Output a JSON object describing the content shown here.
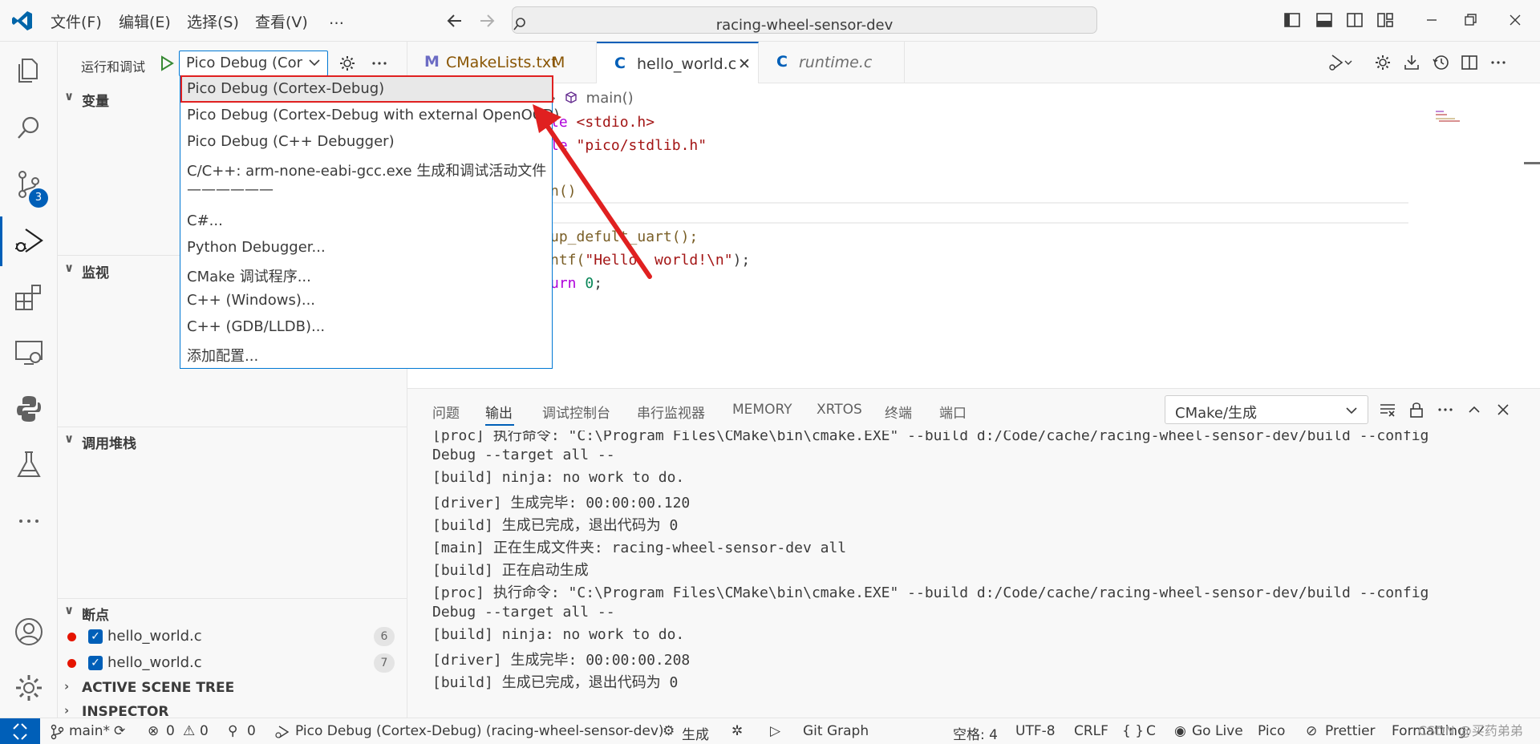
{
  "window": {
    "menus": [
      "文件(F)",
      "编辑(E)",
      "选择(S)",
      "查看(V)",
      "…"
    ],
    "search_text": "racing-wheel-sensor-dev"
  },
  "activity_bar": {
    "source_control_badge": "3"
  },
  "sidebar": {
    "title": "运行和调试",
    "selected_config": "Pico Debug (Cor",
    "sections": {
      "variables": "变量",
      "watch": "监视",
      "call_stack": "调用堆栈",
      "breakpoints": "断点",
      "active_scene_tree": "ACTIVE SCENE TREE",
      "inspector": "INSPECTOR"
    },
    "breakpoints": [
      {
        "file": "hello_world.c",
        "line": "6"
      },
      {
        "file": "hello_world.c",
        "line": "7"
      }
    ]
  },
  "dropdown": {
    "items": [
      "Pico Debug (Cortex-Debug)",
      "Pico Debug (Cortex-Debug with external OpenOCD)",
      "Pico Debug (C++ Debugger)",
      "C/C++: arm-none-eabi-gcc.exe 生成和调试活动文件",
      "——————",
      "C#...",
      "Python Debugger...",
      "CMake 调试程序...",
      "C++ (Windows)...",
      "C++ (GDB/LLDB)...",
      "添加配置..."
    ]
  },
  "tabs": [
    {
      "icon": "M",
      "label": "CMakeLists.txt",
      "suffix": "M"
    },
    {
      "icon": "C",
      "label": "hello_world.c",
      "suffix": "✕"
    },
    {
      "icon": "C",
      "label": "runtime.c",
      "suffix": ""
    }
  ],
  "editor": {
    "breadcrumb": "main()",
    "code": {
      "l1_kw": "le",
      "l1_rest": "<stdio.h>",
      "l2_kw": "le",
      "l2_rest": "\"pico/stdlib.h\"",
      "l4": "n()",
      "l6_a": "up_def",
      "l6_b": "ult_uart();",
      "l7_a": "ntf(",
      "l7_str": "\"Hello, world!\\n\"",
      "l7_end": ");",
      "l8_kw": "urn",
      "l8_num": " 0",
      "l8_end": ";"
    }
  },
  "panel": {
    "tabs": [
      "问题",
      "输出",
      "调试控制台",
      "串行监视器",
      "MEMORY",
      "XRTOS",
      "终端",
      "端口"
    ],
    "output_channel": "CMake/生成",
    "lines": [
      "[proc] 执行命令: \"C:\\Program Files\\CMake\\bin\\cmake.EXE\" --build d:/Code/cache/racing-wheel-sensor-dev/build --config",
      "Debug --target all --",
      "[build] ninja: no work to do.",
      "[driver] 生成完毕: 00:00:00.120",
      "[build] 生成已完成，退出代码为 0",
      "[main] 正在生成文件夹: racing-wheel-sensor-dev all",
      "[build] 正在启动生成",
      "[proc] 执行命令: \"C:\\Program Files\\CMake\\bin\\cmake.EXE\" --build d:/Code/cache/racing-wheel-sensor-dev/build --config",
      "Debug --target all --",
      "[build] ninja: no work to do.",
      "[driver] 生成完毕: 00:00:00.208",
      "[build] 生成已完成，退出代码为 0"
    ]
  },
  "statusbar": {
    "branch": "main*",
    "errors": "0",
    "warnings": "0",
    "ports": "0",
    "debug_config": "Pico Debug (Cortex-Debug) (racing-wheel-sensor-dev)",
    "build": "生成",
    "git_graph": "Git Graph",
    "spaces": "空格: 4",
    "encoding": "UTF-8",
    "eol": "CRLF",
    "language": "C",
    "go_live": "Go Live",
    "pico": "Pico",
    "prettier": "Prettier",
    "formatting": "Formatting: ✓",
    "watermark": "CSDN @买药弟弟"
  },
  "colors": {
    "accent": "#005fb8",
    "highlight_border": "#e02020",
    "arrow": "#e02020",
    "keyword": "#af00db",
    "string": "#a31515",
    "function": "#795e26",
    "number": "#098658"
  }
}
